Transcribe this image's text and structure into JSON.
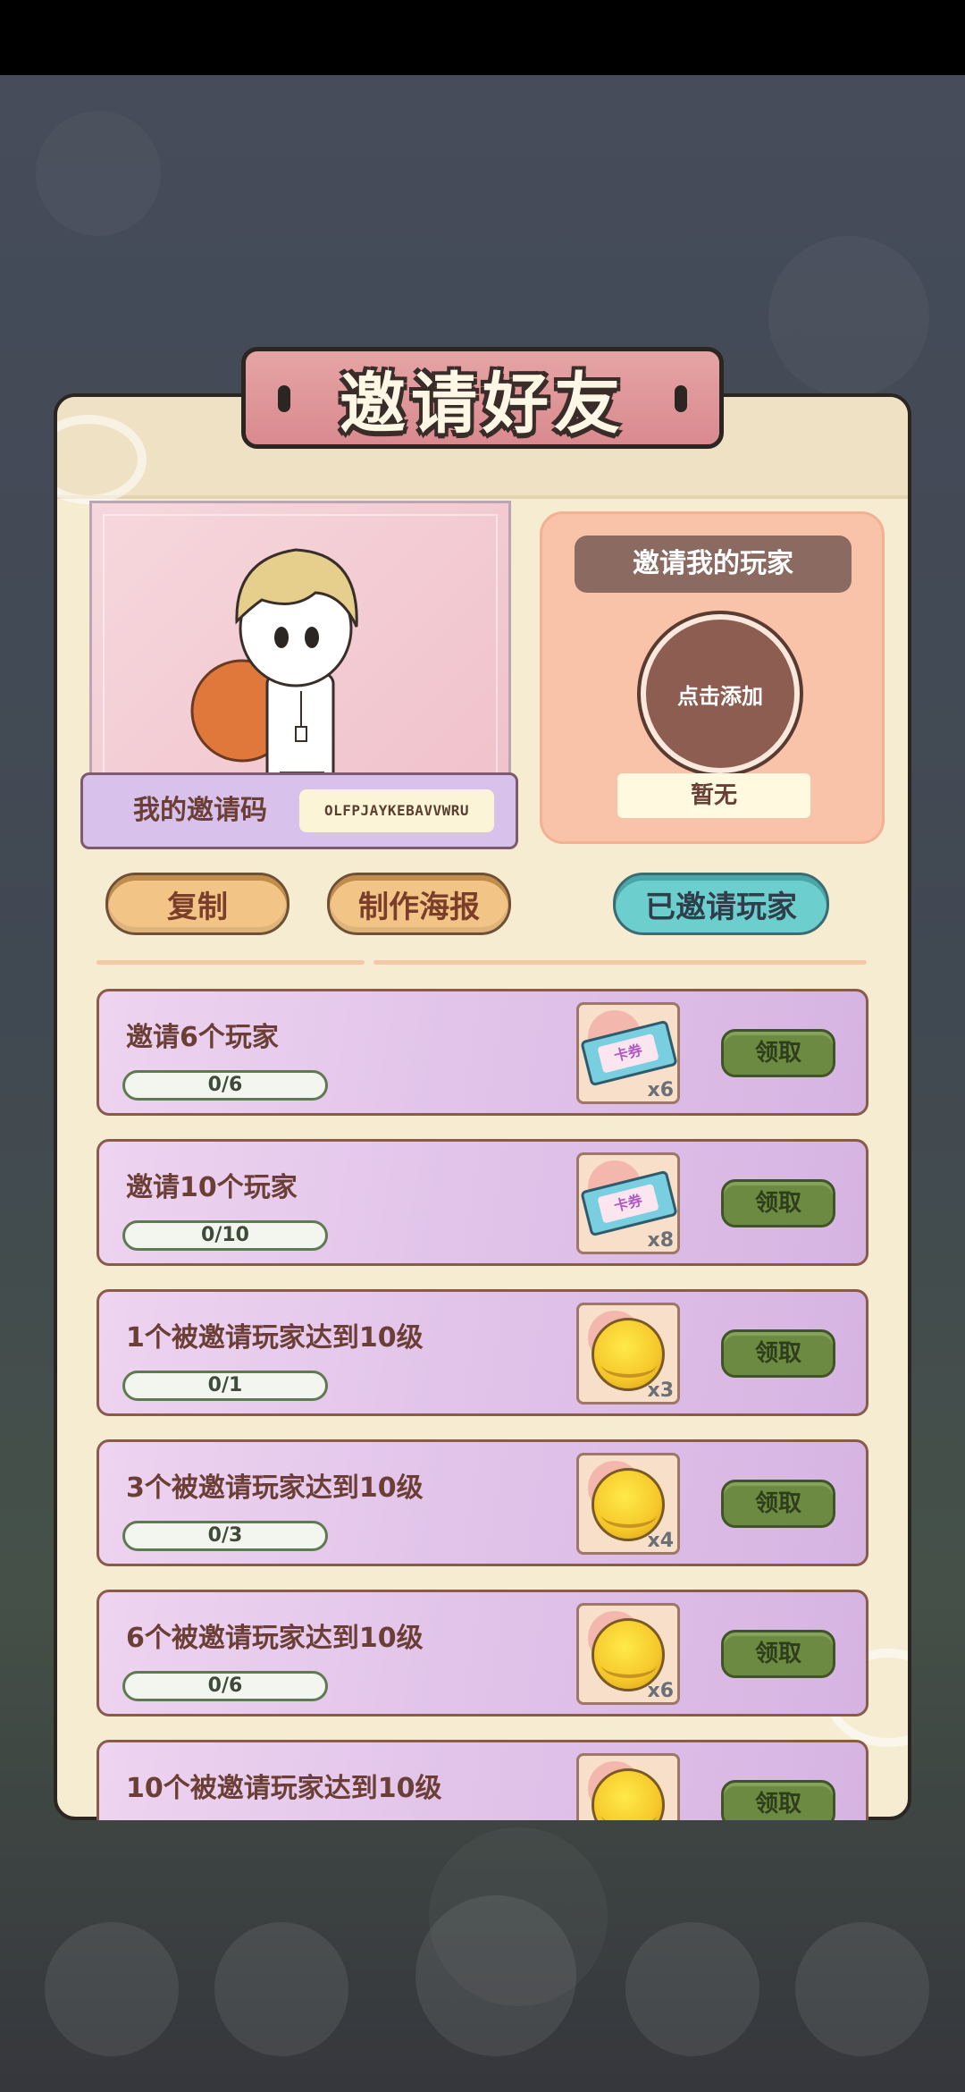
{
  "title": "邀请好友",
  "invite_code": {
    "label": "我的邀请码",
    "value": "OLFPJAYKEBAVVWRU"
  },
  "inviter": {
    "label": "邀请我的玩家",
    "add_label": "点击添加",
    "name_placeholder": "暂无"
  },
  "buttons": {
    "copy": "复制",
    "poster": "制作海报",
    "invited_players": "已邀请玩家"
  },
  "tasks": [
    {
      "title": "邀请6个玩家",
      "progress": "0/6",
      "reward_icon": "ticket-icon",
      "reward_text": "卡券",
      "quantity": "x6",
      "claim": "领取"
    },
    {
      "title": "邀请10个玩家",
      "progress": "0/10",
      "reward_icon": "ticket-icon",
      "reward_text": "卡券",
      "quantity": "x8",
      "claim": "领取"
    },
    {
      "title": "1个被邀请玩家达到10级",
      "progress": "0/1",
      "reward_icon": "coin-icon",
      "quantity": "x3",
      "claim": "领取"
    },
    {
      "title": "3个被邀请玩家达到10级",
      "progress": "0/3",
      "reward_icon": "coin-icon",
      "quantity": "x4",
      "claim": "领取"
    },
    {
      "title": "6个被邀请玩家达到10级",
      "progress": "0/6",
      "reward_icon": "coin-icon",
      "quantity": "x6",
      "claim": "领取"
    },
    {
      "title": "10个被邀请玩家达到10级",
      "progress": "",
      "reward_icon": "coin-icon",
      "quantity": "",
      "claim": "领取"
    }
  ],
  "colors": {
    "panel_bg": "#f6ecd2",
    "title_plate": "#d98a8f",
    "task_row": "#e2c4ea",
    "claim_button": "#6d8a42",
    "teal_button": "#6ccfce",
    "orange_button": "#f2c485"
  }
}
